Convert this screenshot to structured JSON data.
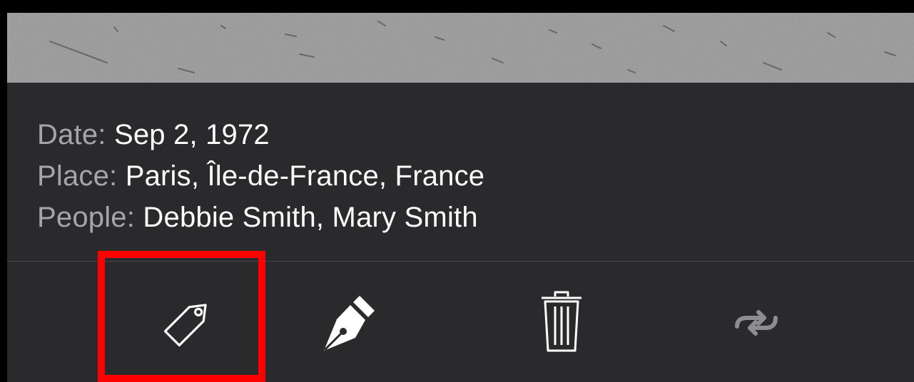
{
  "photo": {
    "icon": "lunar-surface-photo"
  },
  "info": {
    "date_label": "Date:",
    "date_value": "Sep 2, 1972",
    "place_label": "Place:",
    "place_value": "Paris, Île-de-France, France",
    "people_label": "People:",
    "people_value": "Debbie Smith, Mary Smith"
  },
  "toolbar": {
    "buttons": [
      {
        "icon": "tag-icon",
        "selected": true
      },
      {
        "icon": "pen-nib-icon"
      },
      {
        "icon": "trash-icon"
      },
      {
        "icon": "swap-arrows-icon",
        "disabled": true
      }
    ]
  },
  "colors": {
    "panel_background": "#2a2a2c",
    "label": "#a6a6a8",
    "value": "#ffffff",
    "highlight": "#ff0000",
    "disabled_icon": "#8e8e90"
  }
}
